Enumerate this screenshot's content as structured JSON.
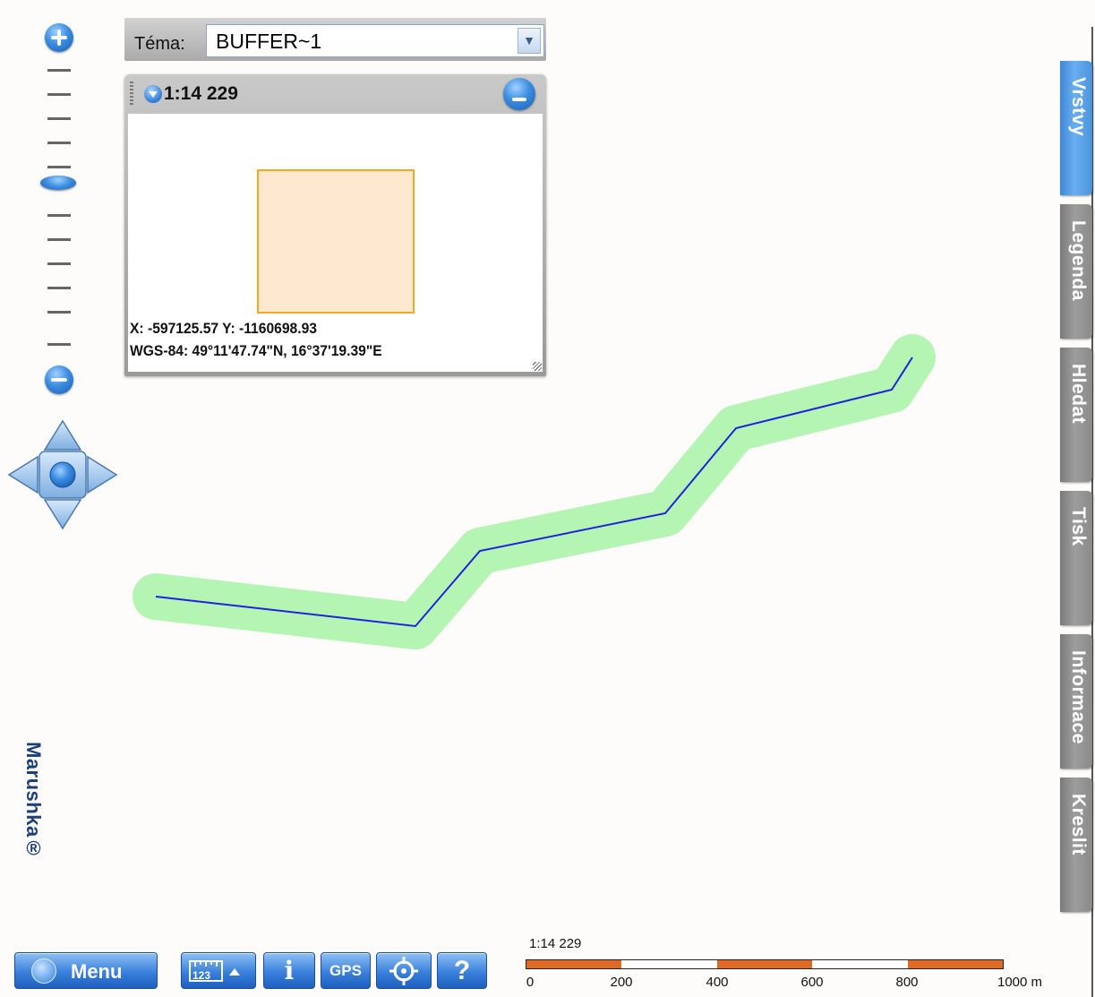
{
  "theme": {
    "label": "Téma:",
    "selected": "BUFFER~1"
  },
  "overview": {
    "scale": "1:14 229",
    "coords_xy": "X: -597125.57 Y: -1160698.93",
    "coords_wgs": "WGS-84: 49°11'47.74\"N, 16°37'19.39\"E"
  },
  "side_tabs": [
    {
      "label": "Vrstvy",
      "active": true
    },
    {
      "label": "Legenda",
      "active": false
    },
    {
      "label": "Hledat",
      "active": false
    },
    {
      "label": "Tisk",
      "active": false
    },
    {
      "label": "Informace",
      "active": false
    },
    {
      "label": "Kreslit",
      "active": false
    }
  ],
  "brand": "Marushka®",
  "toolbar": {
    "menu_label": "Menu",
    "measure_glyph": "123",
    "info_label": "i",
    "gps_label": "GPS",
    "help_label": "?"
  },
  "scalebar": {
    "ratio": "1:14 229",
    "ticks": [
      "0",
      "200",
      "400",
      "600",
      "800",
      "1000 m"
    ]
  },
  "colors": {
    "buffer": "#b4f5b4",
    "line": "#2222dd",
    "extent_fill": "#fde9cf",
    "extent_stroke": "#f4a81e",
    "active_tab": "#4d93dc",
    "inactive_tab": "#8a8a8a"
  },
  "icons": {
    "zoom_in": "plus-icon",
    "zoom_out": "minus-icon",
    "pan": "pan-arrows-icon",
    "locate": "crosshair-icon"
  }
}
